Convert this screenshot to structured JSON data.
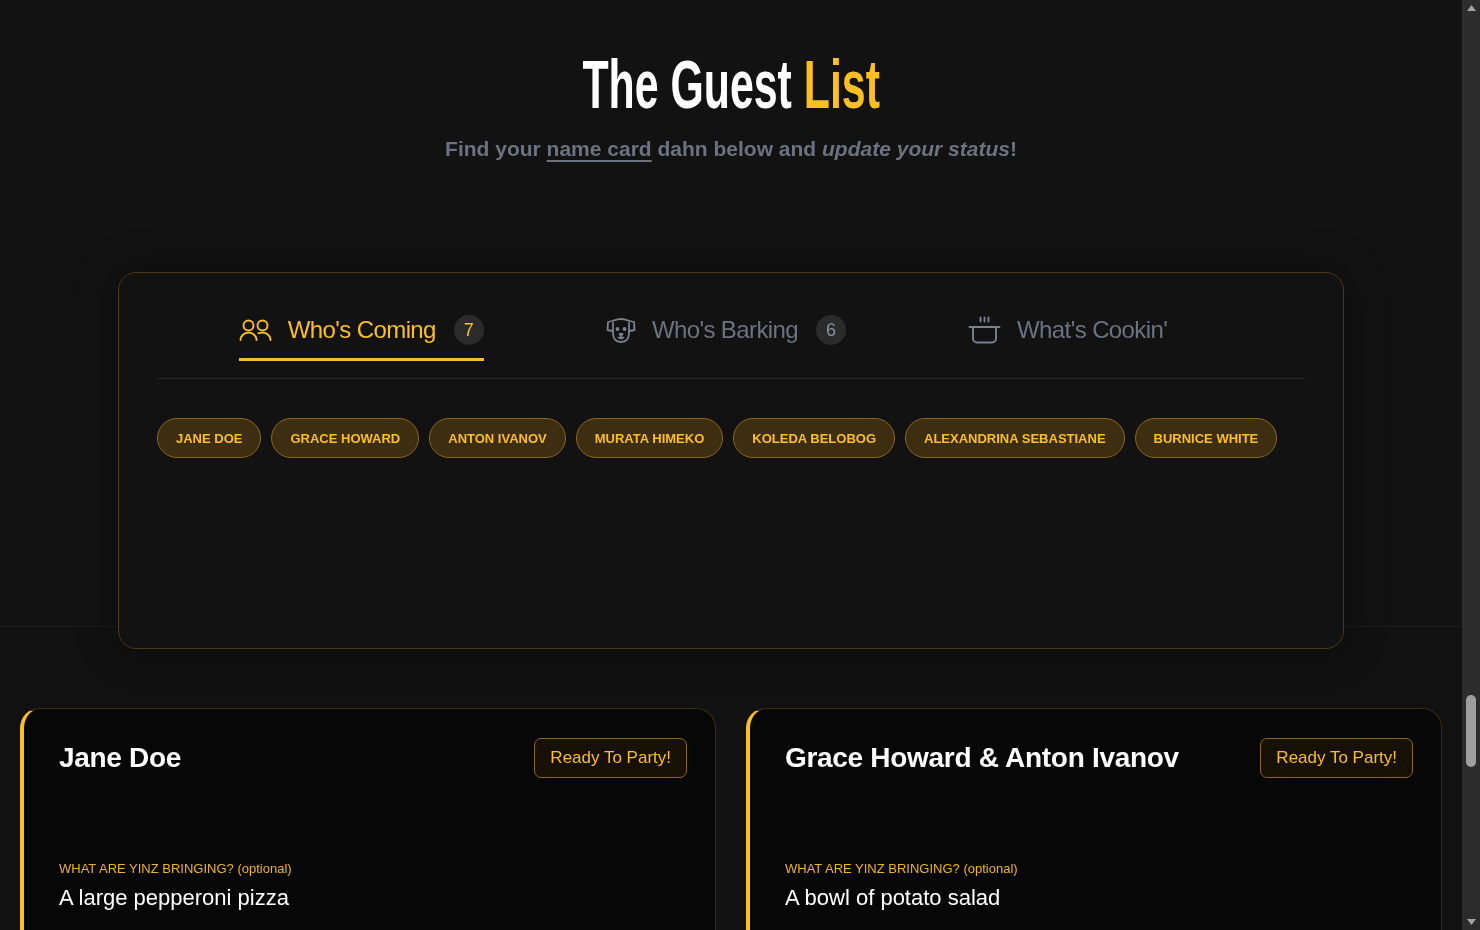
{
  "header": {
    "title": "The Guest",
    "title_accent": "List",
    "subtitle": {
      "before": "Find your",
      "link": "name card",
      "after": "dahn below and *update your status*!"
    }
  },
  "tabs": [
    {
      "label": "Who's Coming",
      "count": "7",
      "selected": true
    },
    {
      "label": "Who's Barking",
      "count": "6",
      "selected": false
    },
    {
      "label": "What's Cookin'",
      "selected": false
    }
  ],
  "guest_chips": [
    "JANE DOE",
    "GRACE HOWARD",
    "ANTON IVANOV",
    "MURATA HIMEKO",
    "KOLEDA BELOBOG",
    "ALEXANDRINA SEBASTIANE",
    "BURNICE WHITE"
  ],
  "cards": [
    {
      "name": "Jane Doe",
      "status": "Ready To Party!",
      "bringing_label": "WHAT ARE YINZ BRINGING? (optional)",
      "bringing": "A large pepperoni pizza"
    },
    {
      "name": "Grace Howard & Anton Ivanov",
      "status": "Ready To Party!",
      "bringing_label": "WHAT ARE YINZ BRINGING? (optional)",
      "bringing": "A bowl of potato salad"
    }
  ]
}
